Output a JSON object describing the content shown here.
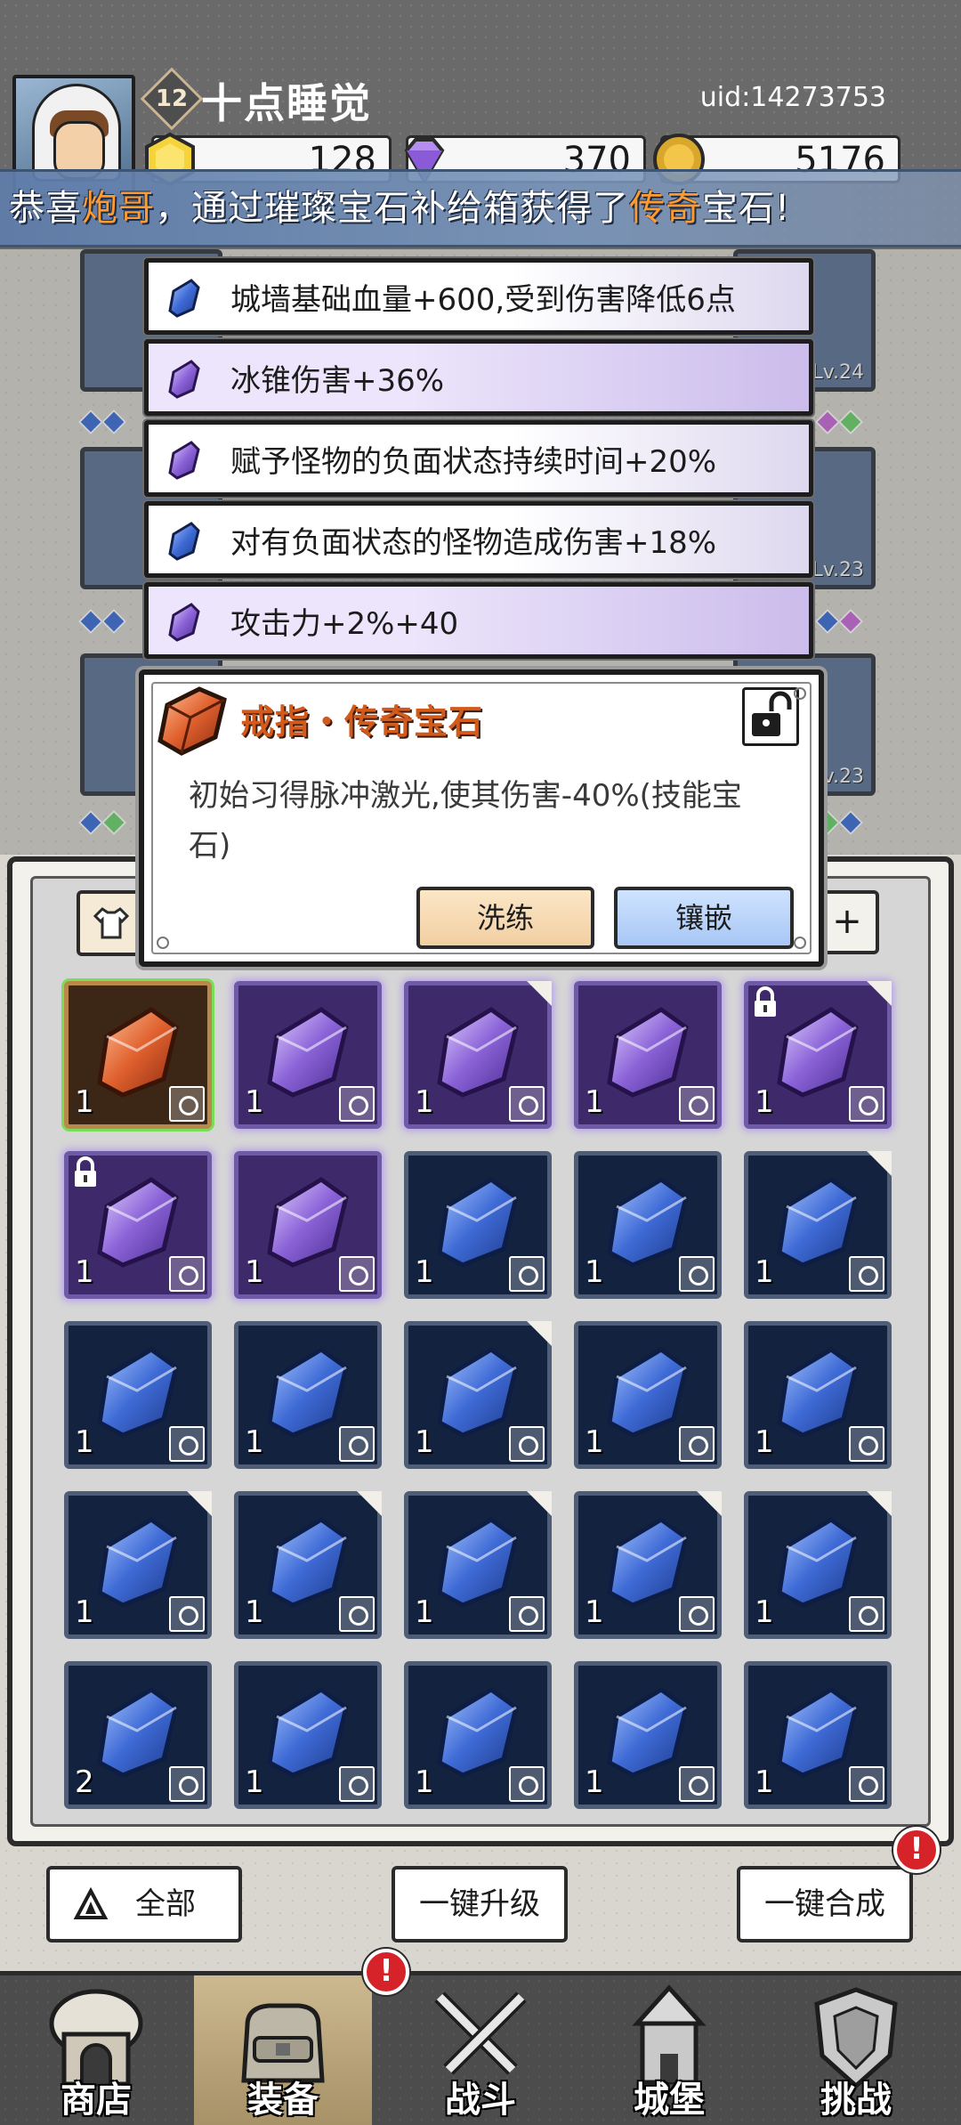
{
  "player": {
    "level": "12",
    "name": "十点睡觉",
    "uid": "uid:14273753"
  },
  "currencies": {
    "gold": "128",
    "gems": "370",
    "coins": "5176"
  },
  "broadcast": {
    "prefix": "恭喜",
    "player": "炮哥",
    "middle": "，通过璀璨宝石补给箱获得了",
    "rarity": "传奇",
    "suffix": "宝石!"
  },
  "equipment_levels": [
    "Lv.24",
    "Lv.23",
    "Lv.23"
  ],
  "affixes": [
    {
      "text": "城墙基础血量+600,受到伤害降低6点",
      "tier": "blue"
    },
    {
      "text": "冰锥伤害+36%",
      "tier": "purple"
    },
    {
      "text": "赋予怪物的负面状态持续时间+20%",
      "tier": "purple"
    },
    {
      "text": "对有负面状态的怪物造成伤害+18%",
      "tier": "blue"
    },
    {
      "text": "攻击力+2%+40",
      "tier": "purple"
    }
  ],
  "gem_card": {
    "title": "戒指・传奇宝石",
    "description": "初始习得脉冲激光,使其伤害-40%(技能宝石)",
    "refine_label": "洗练",
    "inlay_label": "镶嵌"
  },
  "filter_plus": "+",
  "gem_grid": [
    {
      "tier": "orange",
      "count": "1",
      "locked": false,
      "new": false
    },
    {
      "tier": "purple",
      "count": "1",
      "locked": false,
      "new": false
    },
    {
      "tier": "purple",
      "count": "1",
      "locked": false,
      "new": true
    },
    {
      "tier": "purple",
      "count": "1",
      "locked": false,
      "new": false
    },
    {
      "tier": "purple",
      "count": "1",
      "locked": true,
      "new": true
    },
    {
      "tier": "purple",
      "count": "1",
      "locked": true,
      "new": false
    },
    {
      "tier": "purple",
      "count": "1",
      "locked": false,
      "new": false
    },
    {
      "tier": "blue",
      "count": "1",
      "locked": false,
      "new": false
    },
    {
      "tier": "blue",
      "count": "1",
      "locked": false,
      "new": false
    },
    {
      "tier": "blue",
      "count": "1",
      "locked": false,
      "new": true
    },
    {
      "tier": "blue",
      "count": "1",
      "locked": false,
      "new": false
    },
    {
      "tier": "blue",
      "count": "1",
      "locked": false,
      "new": false
    },
    {
      "tier": "blue",
      "count": "1",
      "locked": false,
      "new": true
    },
    {
      "tier": "blue",
      "count": "1",
      "locked": false,
      "new": false
    },
    {
      "tier": "blue",
      "count": "1",
      "locked": false,
      "new": false
    },
    {
      "tier": "blue",
      "count": "1",
      "locked": false,
      "new": true
    },
    {
      "tier": "blue",
      "count": "1",
      "locked": false,
      "new": true
    },
    {
      "tier": "blue",
      "count": "1",
      "locked": false,
      "new": true
    },
    {
      "tier": "blue",
      "count": "1",
      "locked": false,
      "new": true
    },
    {
      "tier": "blue",
      "count": "1",
      "locked": false,
      "new": true
    },
    {
      "tier": "blue",
      "count": "2",
      "locked": false,
      "new": false
    },
    {
      "tier": "blue",
      "count": "1",
      "locked": false,
      "new": false
    },
    {
      "tier": "blue",
      "count": "1",
      "locked": false,
      "new": false
    },
    {
      "tier": "blue",
      "count": "1",
      "locked": false,
      "new": false
    },
    {
      "tier": "blue",
      "count": "1",
      "locked": false,
      "new": false
    }
  ],
  "actions": {
    "all": "全部",
    "upgrade": "一键升级",
    "merge": "一键合成",
    "alert_mark": "!"
  },
  "nav": [
    {
      "label": "商店",
      "icon": "shop-icon",
      "active": false
    },
    {
      "label": "装备",
      "icon": "equipment-bag-icon",
      "active": true
    },
    {
      "label": "战斗",
      "icon": "crossed-swords-icon",
      "active": false
    },
    {
      "label": "城堡",
      "icon": "castle-icon",
      "active": false
    },
    {
      "label": "挑战",
      "icon": "challenge-shield-icon",
      "active": false
    }
  ],
  "colors": {
    "rarity_orange": "#d25a1b",
    "broadcast_highlight": "#ff9a2e",
    "purple_tier": "#6e5aa6",
    "blue_tier": "#4f5e76",
    "alert_red": "#d6232a"
  }
}
